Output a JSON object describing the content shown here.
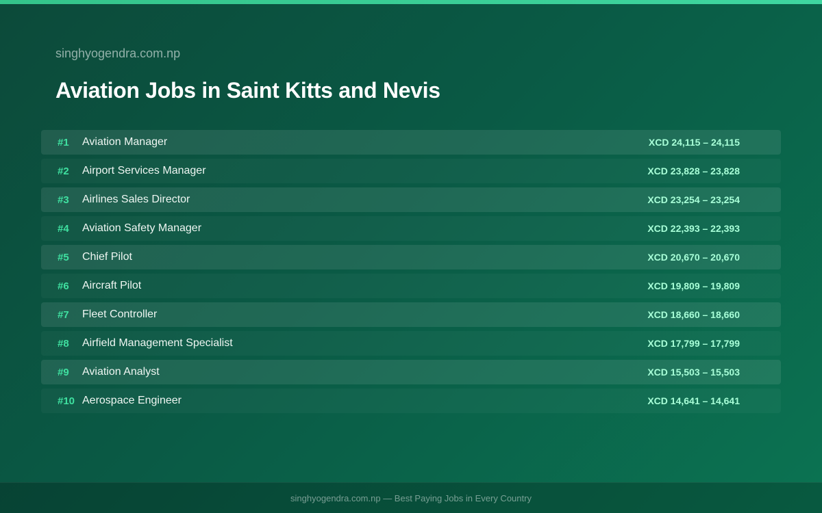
{
  "header": {
    "site": "singhyogendra.com.np",
    "title": "Aviation Jobs in Saint Kitts and Nevis"
  },
  "jobs": [
    {
      "rank": "#1",
      "name": "Aviation Manager",
      "salary": "XCD 24,115 – 24,115"
    },
    {
      "rank": "#2",
      "name": "Airport Services Manager",
      "salary": "XCD 23,828 – 23,828"
    },
    {
      "rank": "#3",
      "name": "Airlines Sales Director",
      "salary": "XCD 23,254 – 23,254"
    },
    {
      "rank": "#4",
      "name": "Aviation Safety Manager",
      "salary": "XCD 22,393 – 22,393"
    },
    {
      "rank": "#5",
      "name": "Chief Pilot",
      "salary": "XCD 20,670 – 20,670"
    },
    {
      "rank": "#6",
      "name": "Aircraft Pilot",
      "salary": "XCD 19,809 – 19,809"
    },
    {
      "rank": "#7",
      "name": "Fleet Controller",
      "salary": "XCD 18,660 – 18,660"
    },
    {
      "rank": "#8",
      "name": "Airfield Management Specialist",
      "salary": "XCD 17,799 – 17,799"
    },
    {
      "rank": "#9",
      "name": "Aviation Analyst",
      "salary": "XCD 15,503 – 15,503"
    },
    {
      "rank": "#10",
      "name": "Aerospace Engineer",
      "salary": "XCD 14,641 – 14,641"
    }
  ],
  "footer": {
    "text": "singhyogendra.com.np — Best Paying Jobs in Every Country"
  },
  "colors": {
    "accent": "#3fe0a0",
    "salary": "#a8ffd8",
    "background": "#0a5a45"
  }
}
